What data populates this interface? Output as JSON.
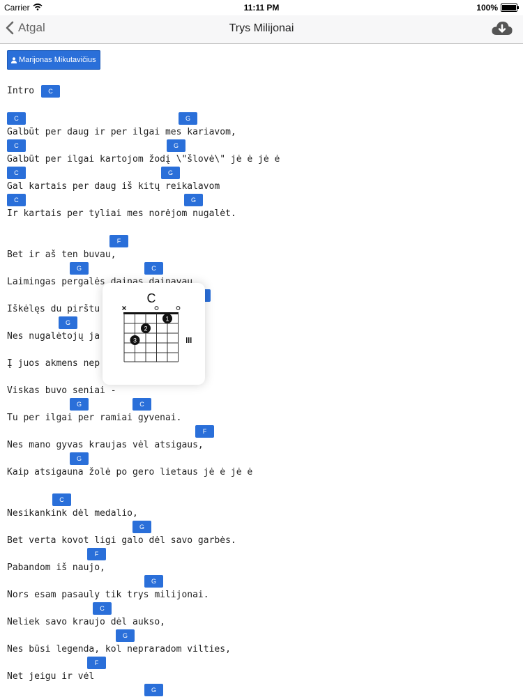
{
  "status": {
    "carrier": "Carrier",
    "time": "11:11 PM",
    "battery": "100%",
    "battery_level": 1.0
  },
  "nav": {
    "back_label": "Atgal",
    "title": "Trys Milijonai",
    "action_icon": "cloud-download-icon"
  },
  "artist": {
    "label": "Marijonas Mikutavičius"
  },
  "lyrics": [
    "Intro",
    "Galbūt per daug ir per ilgai mes kariavom,",
    "Galbūt per ilgai kartojom žodį \\\"šlovė\\\" jė ė jė ė",
    "Gal kartais per daug iš kitų reikalavom",
    "Ir kartais per tyliai mes norėjom nugalėt.",
    "Bet ir aš ten buvau,",
    "Laimingas pergalės dainas dainavau,",
    "Iškėlęs du pirštu",
    "Nes nugalėtojų ja",
    "Į juos akmens nep",
    "Viskas buvo seniai -",
    "Tu per ilgai per ramiai gyvenai.",
    "Nes mano gyvas kraujas vėl atsigaus,",
    "Kaip atsigauna žolė po gero lietaus jė ė jė ė",
    "Nesikankink dėl medalio,",
    "Bet verta kovot ligi galo dėl savo garbės.",
    "Pabandom iš naujo,",
    "Nors esam pasauly tik trys milijonai.",
    "Neliek savo kraujo dėl aukso,",
    "Nes būsi legenda, kol nepraradom vilties,",
    "Net jeigu ir vėl"
  ],
  "chords": [
    "C",
    "C",
    "G",
    "C",
    "G",
    "C",
    "G",
    "C",
    "G",
    "F",
    "G",
    "C",
    "F",
    "G",
    "G",
    "C",
    "F",
    "G",
    "C",
    "G",
    "F",
    "G",
    "C",
    "G",
    "F",
    "G"
  ],
  "popup": {
    "chord_name": "C"
  }
}
